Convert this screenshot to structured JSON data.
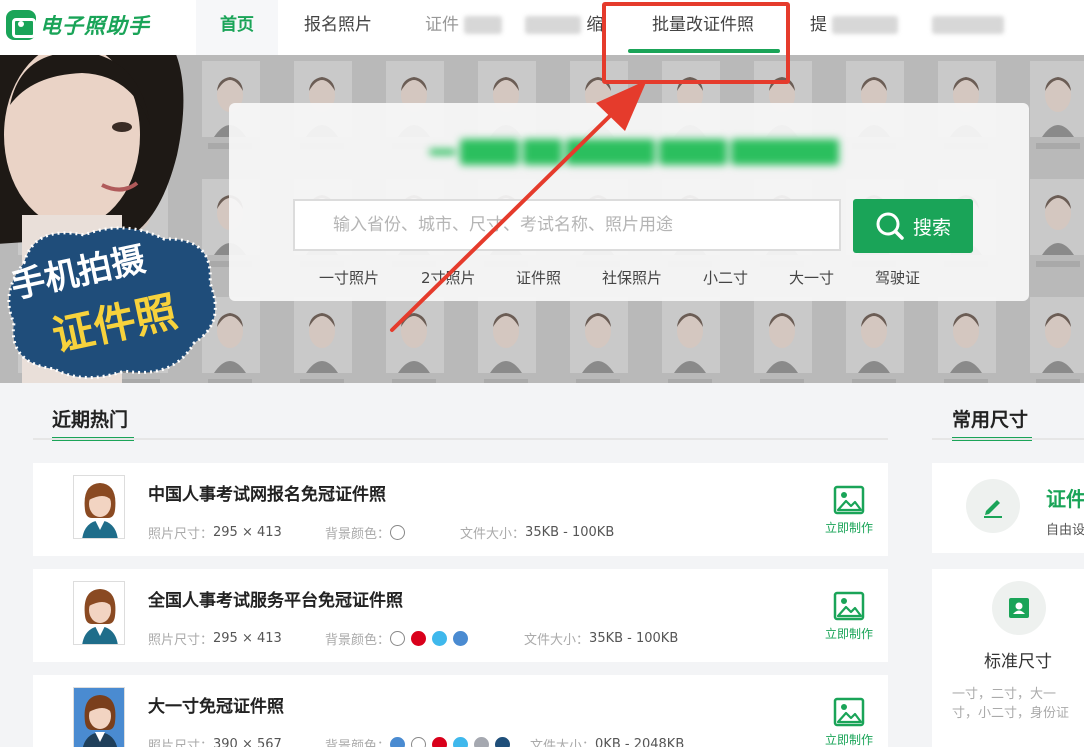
{
  "brand": {
    "name": "电子照助手"
  },
  "nav": {
    "items": [
      {
        "label": "首页",
        "active": true
      },
      {
        "label": "报名照片"
      },
      {
        "label": "证件"
      },
      {
        "label": "缩"
      },
      {
        "label": "批量改证件照",
        "highlighted": true
      },
      {
        "label": "提"
      },
      {
        "label": ""
      }
    ]
  },
  "hero": {
    "promo_line1": "手机拍摄",
    "promo_line2": "证件照",
    "title": "全网证件照",
    "search": {
      "placeholder": "输入省份、城市、尺寸、考试名称、照片用途",
      "button_label": "搜索"
    },
    "quick_tags": [
      "一寸照片",
      "2寸照片",
      "证件照",
      "社保照片",
      "小二寸",
      "大一寸",
      "驾驶证"
    ]
  },
  "recent": {
    "heading": "近期热门",
    "size_label": "照片尺寸：",
    "bg_label": "背景颜色：",
    "file_label": "文件大小：",
    "make_label": "立即制作",
    "items": [
      {
        "title": "中国人事考试网报名免冠证件照",
        "size": "295 × 413",
        "file_size": "35KB - 100KB",
        "colors": [
          "#ffffff"
        ],
        "thumb_bg": "#ffffff"
      },
      {
        "title": "全国人事考试服务平台免冠证件照",
        "size": "295 × 413",
        "file_size": "35KB - 100KB",
        "colors": [
          "#ffffff",
          "#d9001b",
          "#3fb8ec",
          "#4a8bd1"
        ],
        "thumb_bg": "#ffffff"
      },
      {
        "title": "大一寸免冠证件照",
        "size": "390 × 567",
        "file_size": "0KB - 2048KB",
        "colors": [
          "#4a8bd1",
          "#ffffff",
          "#d9001b",
          "#3fb8ec",
          "#a5a8b0",
          "#1f4f7a"
        ],
        "thumb_bg": "#4a8bd1"
      }
    ]
  },
  "common_sizes": {
    "heading": "常用尺寸",
    "custom_title": "证件",
    "custom_sub": "自由设",
    "standard_title": "标准尺寸",
    "standard_desc_1": "一寸，二寸，大一",
    "standard_desc_2": "寸，小二寸，身份证"
  },
  "colors": {
    "brand_green": "#1aa458",
    "annotation_red": "#e53b2c"
  }
}
